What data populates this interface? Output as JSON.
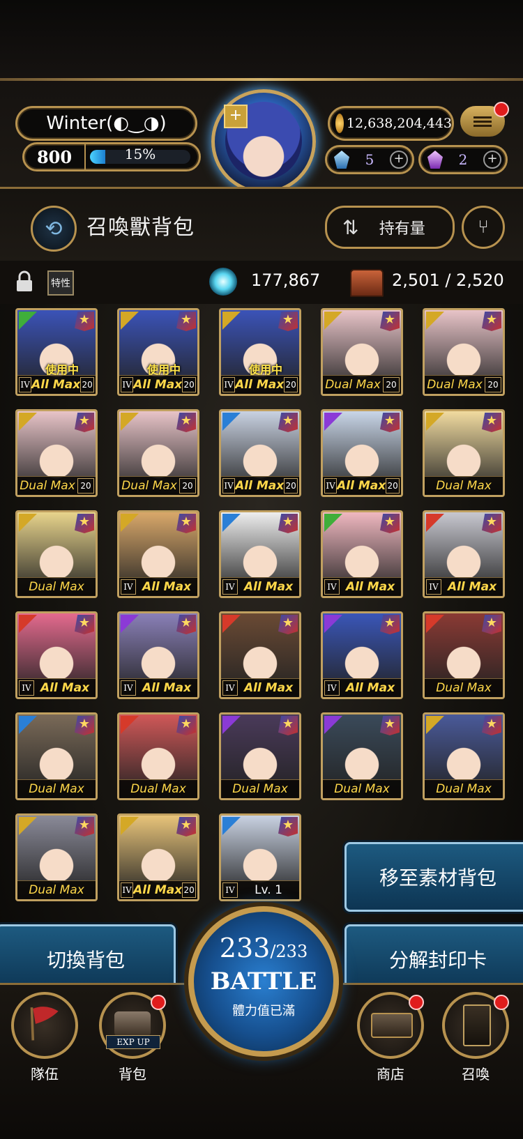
{
  "header": {
    "player_name": "Winter(◐‿◑)",
    "level": "800",
    "exp_percent": "15%",
    "exp_fraction": 0.15,
    "gold": "12,638,204,443",
    "gems": "5",
    "crystals": "2"
  },
  "title_bar": {
    "title": "召喚獸背包",
    "sort_label": "持有量"
  },
  "stats": {
    "trait_label": "特性",
    "orbs": "177,867",
    "capacity": "2,501 / 2,520"
  },
  "colors": {
    "gold_border": "#c0a060",
    "label_yellow": "#ffd84a",
    "button_blue": "#1d5a80",
    "elem_green": "#3fae3a",
    "elem_yellow": "#d4a826",
    "elem_blue": "#2a7fd6",
    "elem_purple": "#8b3ad6",
    "elem_red": "#d63a2a"
  },
  "cards": [
    {
      "elem": "green",
      "label": "All Max",
      "rank": "IV",
      "lv": "20",
      "inuse": "使用中",
      "art": "#3b53b8"
    },
    {
      "elem": "yellow",
      "label": "All Max",
      "rank": "IV",
      "lv": "20",
      "inuse": "使用中",
      "art": "#3b53b8"
    },
    {
      "elem": "yellow",
      "label": "All Max",
      "rank": "IV",
      "lv": "20",
      "inuse": "使用中",
      "art": "#3b53b8"
    },
    {
      "elem": "yellow",
      "label": "Dual Max",
      "rank": "",
      "lv": "20",
      "inuse": "",
      "art": "#e8c4c8"
    },
    {
      "elem": "yellow",
      "label": "Dual Max",
      "rank": "",
      "lv": "20",
      "inuse": "",
      "art": "#e8c4c8"
    },
    {
      "elem": "yellow",
      "label": "Dual Max",
      "rank": "",
      "lv": "20",
      "inuse": "",
      "art": "#e8c4c8"
    },
    {
      "elem": "yellow",
      "label": "Dual Max",
      "rank": "",
      "lv": "20",
      "inuse": "",
      "art": "#e8c4c8"
    },
    {
      "elem": "blue",
      "label": "All Max",
      "rank": "IV",
      "lv": "20",
      "inuse": "",
      "art": "#c9d2e2"
    },
    {
      "elem": "purple",
      "label": "All Max",
      "rank": "IV",
      "lv": "20",
      "inuse": "",
      "art": "#c9d6e8"
    },
    {
      "elem": "yellow",
      "label": "Dual Max",
      "rank": "",
      "lv": "",
      "inuse": "",
      "art": "#f1dba0"
    },
    {
      "elem": "yellow",
      "label": "Dual Max",
      "rank": "",
      "lv": "",
      "inuse": "",
      "art": "#e8d48c"
    },
    {
      "elem": "yellow",
      "label": "All Max",
      "rank": "IV",
      "lv": "",
      "inuse": "",
      "art": "#d9a86a"
    },
    {
      "elem": "blue",
      "label": "All Max",
      "rank": "IV",
      "lv": "",
      "inuse": "",
      "art": "#eeeeee"
    },
    {
      "elem": "green",
      "label": "All Max",
      "rank": "IV",
      "lv": "",
      "inuse": "",
      "art": "#f0b8c0"
    },
    {
      "elem": "red",
      "label": "All Max",
      "rank": "IV",
      "lv": "",
      "inuse": "",
      "art": "#c8c8d0"
    },
    {
      "elem": "red",
      "label": "All Max",
      "rank": "IV",
      "lv": "",
      "inuse": "",
      "art": "#e46a8e"
    },
    {
      "elem": "purple",
      "label": "All Max",
      "rank": "IV",
      "lv": "",
      "inuse": "",
      "art": "#8a80b8"
    },
    {
      "elem": "red",
      "label": "All Max",
      "rank": "IV",
      "lv": "",
      "inuse": "",
      "art": "#6a4a34"
    },
    {
      "elem": "purple",
      "label": "All Max",
      "rank": "IV",
      "lv": "",
      "inuse": "",
      "art": "#3a56b8"
    },
    {
      "elem": "red",
      "label": "Dual Max",
      "rank": "",
      "lv": "",
      "inuse": "",
      "art": "#8a3a34"
    },
    {
      "elem": "blue",
      "label": "Dual Max",
      "rank": "",
      "lv": "",
      "inuse": "",
      "art": "#7a6a58"
    },
    {
      "elem": "red",
      "label": "Dual Max",
      "rank": "",
      "lv": "",
      "inuse": "",
      "art": "#d05858"
    },
    {
      "elem": "purple",
      "label": "Dual Max",
      "rank": "",
      "lv": "",
      "inuse": "",
      "art": "#4a3a5a"
    },
    {
      "elem": "purple",
      "label": "Dual Max",
      "rank": "",
      "lv": "",
      "inuse": "",
      "art": "#3a4a5a"
    },
    {
      "elem": "yellow",
      "label": "Dual Max",
      "rank": "",
      "lv": "",
      "inuse": "",
      "art": "#4a5a9a"
    },
    {
      "elem": "yellow",
      "label": "Dual Max",
      "rank": "",
      "lv": "",
      "inuse": "",
      "art": "#8a8a98"
    },
    {
      "elem": "yellow",
      "label": "All Max",
      "rank": "IV",
      "lv": "20",
      "inuse": "",
      "art": "#e8c47a"
    },
    {
      "elem": "blue",
      "label": "Lv. 1",
      "rank": "IV",
      "lv": "",
      "inuse": "",
      "art": "#c9d2e2"
    }
  ],
  "buttons": {
    "move_to_material": "移至素材背包",
    "decompose": "分解封印卡",
    "switch_bag": "切換背包"
  },
  "battle": {
    "current": "233",
    "max": "/233",
    "label": "BATTLE",
    "sub": "體力值已滿"
  },
  "nav": {
    "team": "隊伍",
    "bag": "背包",
    "bag_badge": "EXP UP",
    "shop": "商店",
    "summon": "召喚"
  }
}
